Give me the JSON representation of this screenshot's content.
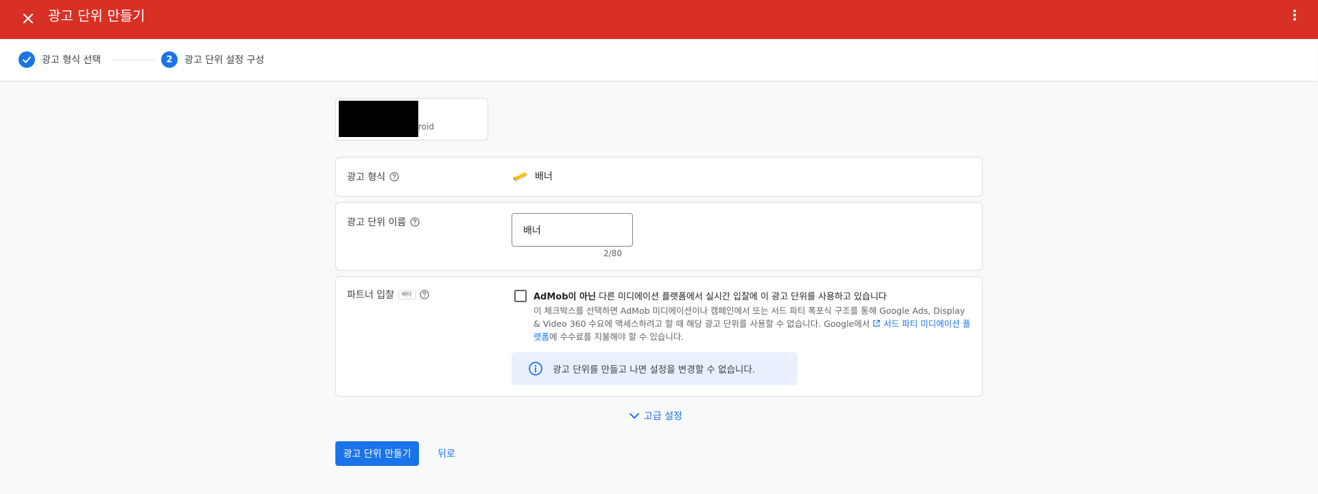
{
  "header": {
    "title": "광고 단위 만들기",
    "close_icon": "close-icon",
    "more_icon": "more-vert-icon",
    "bg_color": "#d93025"
  },
  "stepper": {
    "steps": [
      {
        "label": "광고 형식 선택",
        "state": "done"
      },
      {
        "label": "광고 단위 설정 구성",
        "state": "active",
        "number": "2"
      }
    ]
  },
  "app": {
    "name_suffix": "roid"
  },
  "ad_format": {
    "label": "광고 형식",
    "value": "배너"
  },
  "ad_unit_name": {
    "label": "광고 단위 이름",
    "value": "배너",
    "char_count": "2/80"
  },
  "partner_bidding": {
    "label": "파트너 입찰",
    "beta_badge": "베타",
    "checkbox_title_bold": "AdMob이 아닌",
    "checkbox_title_rest": " 다른 미디에이션 플랫폼에서 실시간 입찰에 이 광고 단위를 사용하고 있습니다",
    "description_1": "이 체크박스를 선택하면 AdMob 미디에이션이나 캠페인에서 또는 서드 파티 폭포식 구조를 통해 Google Ads, Display & Video 360 수요에 액세스하려고 할 때 해당 광고 단위를 사용할 수 없습니다. Google에서 ",
    "link_text": "서드 파티 미디에이션 플랫폼",
    "description_2": "에 수수료를 지불해야 할 수 있습니다.",
    "notice": "광고 단위를 만들고 나면 설정을 변경할 수 없습니다."
  },
  "advanced": {
    "label": "고급 설정"
  },
  "actions": {
    "create_label": "광고 단위 만들기",
    "back_label": "뒤로"
  },
  "colors": {
    "accent": "#1a73e8",
    "notice_bg": "#e8f0fe"
  }
}
